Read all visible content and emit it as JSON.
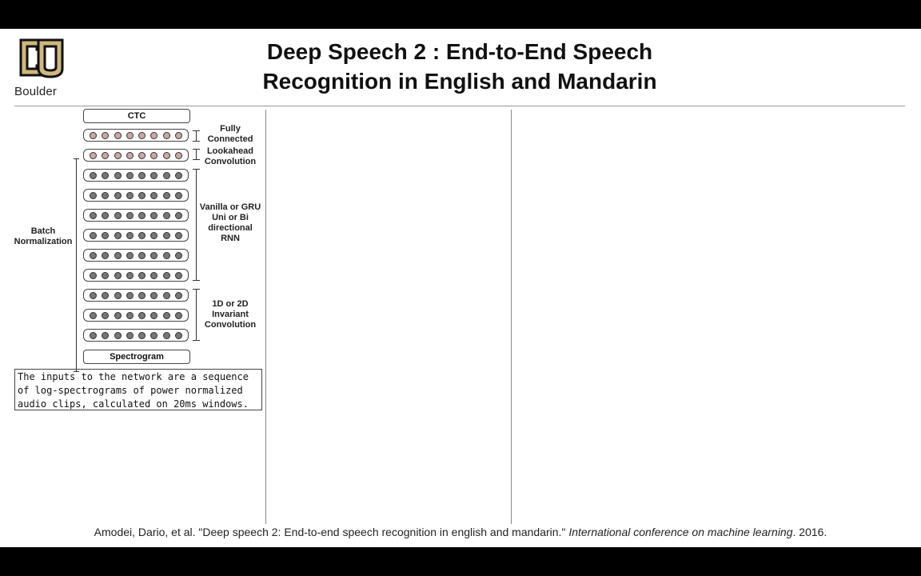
{
  "header": {
    "logo_text": "Boulder",
    "title_line1": "Deep Speech 2 : End-to-End Speech",
    "title_line2": "Recognition in English and Mandarin"
  },
  "diagram": {
    "top_box": "CTC",
    "bottom_box": "Spectrogram",
    "layers": [
      {
        "group": "fc",
        "shade": "light"
      },
      {
        "group": "lookahead",
        "shade": "light"
      },
      {
        "group": "rnn",
        "shade": "dark"
      },
      {
        "group": "rnn",
        "shade": "dark"
      },
      {
        "group": "rnn",
        "shade": "dark"
      },
      {
        "group": "rnn",
        "shade": "dark"
      },
      {
        "group": "rnn",
        "shade": "dark"
      },
      {
        "group": "rnn",
        "shade": "dark"
      },
      {
        "group": "conv",
        "shade": "dark"
      },
      {
        "group": "conv",
        "shade": "dark"
      },
      {
        "group": "conv",
        "shade": "dark"
      }
    ],
    "nodes_per_layer": 8,
    "labels": {
      "fully_connected": "Fully\nConnected",
      "lookahead": "Lookahead\nConvolution",
      "rnn": "Vanilla or GRU\nUni or Bi\ndirectional\nRNN",
      "conv": "1D or 2D\nInvariant\nConvolution",
      "batch_norm": "Batch\nNormalization"
    },
    "colors": {
      "light_node": "#c9a9a4",
      "dark_node": "#777777"
    }
  },
  "note": {
    "text": "The inputs to the network are a sequence\nof log-spectrograms of power normalized\naudio clips, calculated on 20ms windows."
  },
  "citation": {
    "authors": "Amodei, Dario, et al. \"Deep speech 2: End-to-end speech recognition in english and mandarin.\" ",
    "venue": "International conference on machine learning",
    "year": ". 2016."
  }
}
